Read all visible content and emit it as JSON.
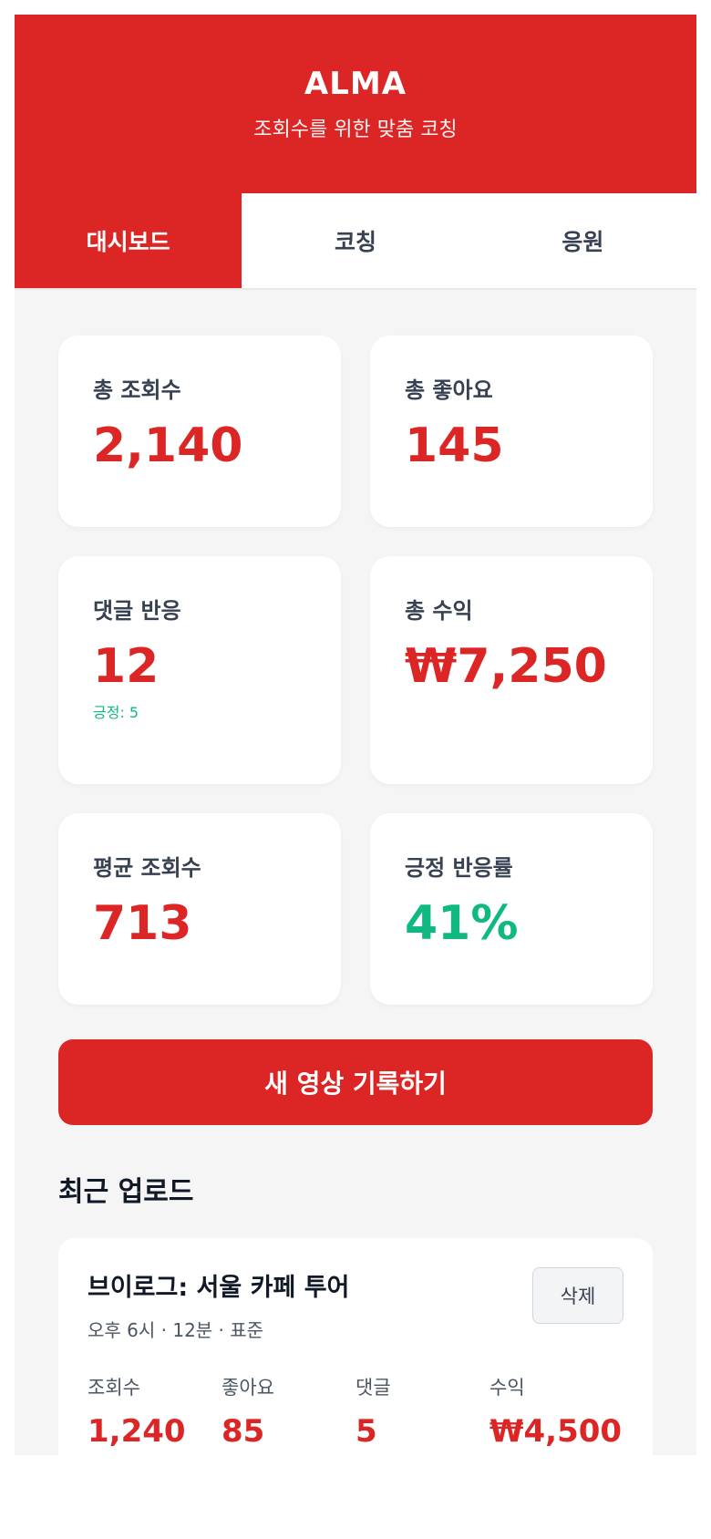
{
  "header": {
    "title": "ALMA",
    "subtitle": "조회수를 위한 맞춤 코칭"
  },
  "tabs": [
    {
      "label": "대시보드",
      "active": true
    },
    {
      "label": "코칭",
      "active": false
    },
    {
      "label": "응원",
      "active": false
    }
  ],
  "stats": {
    "total_views": {
      "label": "총 조회수",
      "value": "2,140"
    },
    "total_likes": {
      "label": "총 좋아요",
      "value": "145"
    },
    "comments": {
      "label": "댓글 반응",
      "value": "12",
      "note": "긍정: 5"
    },
    "revenue": {
      "label": "총 수익",
      "value": "₩7,250"
    },
    "avg_views": {
      "label": "평균 조회수",
      "value": "713"
    },
    "positive_rate": {
      "label": "긍정 반응률",
      "value": "41%"
    }
  },
  "cta": {
    "label": "새 영상 기록하기"
  },
  "recent": {
    "title": "최근 업로드",
    "items": [
      {
        "title": "브이로그: 서울 카페 투어",
        "meta": "오후 6시 · 12분 · 표준",
        "delete_label": "삭제",
        "stats": [
          {
            "label": "조회수",
            "value": "1,240"
          },
          {
            "label": "좋아요",
            "value": "85"
          },
          {
            "label": "댓글",
            "value": "5"
          },
          {
            "label": "수익",
            "value": "₩4,500"
          }
        ]
      }
    ]
  },
  "colors": {
    "primary": "#dc2626",
    "positive": "#10b981",
    "background": "#f5f5f5"
  }
}
